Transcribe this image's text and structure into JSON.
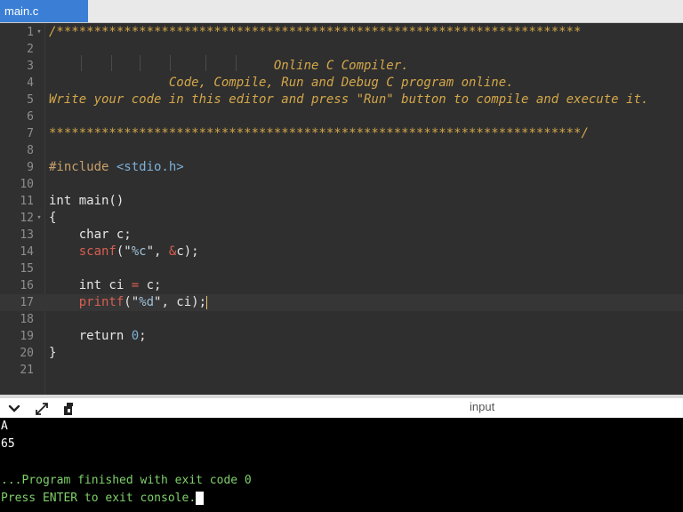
{
  "tab": {
    "label": "main.c"
  },
  "editor": {
    "lines": [
      {
        "num": "1",
        "fold": "-",
        "segments": [
          {
            "t": "/**********************************************************************",
            "c": "cm"
          }
        ]
      },
      {
        "num": "2",
        "fold": "",
        "segments": []
      },
      {
        "num": "3",
        "fold": "",
        "segments": [
          {
            "t": "                              Online C Compiler.",
            "c": "cm"
          }
        ]
      },
      {
        "num": "4",
        "fold": "",
        "segments": [
          {
            "t": "                Code, Compile, Run and Debug C program online.",
            "c": "cm"
          }
        ]
      },
      {
        "num": "5",
        "fold": "",
        "segments": [
          {
            "t": "Write your code in this editor and press \"Run\" button to compile and execute it.",
            "c": "cm"
          }
        ]
      },
      {
        "num": "6",
        "fold": "",
        "segments": []
      },
      {
        "num": "7",
        "fold": "",
        "segments": [
          {
            "t": "***********************************************************************/",
            "c": "cm"
          }
        ]
      },
      {
        "num": "8",
        "fold": "",
        "segments": []
      },
      {
        "num": "9",
        "fold": "",
        "segments": [
          {
            "t": "#include ",
            "c": "pp"
          },
          {
            "t": "<stdio.h>",
            "c": "inc"
          }
        ]
      },
      {
        "num": "10",
        "fold": "",
        "segments": []
      },
      {
        "num": "11",
        "fold": "",
        "segments": [
          {
            "t": "int main()",
            "c": "kw"
          }
        ]
      },
      {
        "num": "12",
        "fold": "-",
        "segments": [
          {
            "t": "{",
            "c": "kw"
          }
        ]
      },
      {
        "num": "13",
        "fold": "",
        "segments": [
          {
            "t": "    char c;",
            "c": "kw"
          }
        ]
      },
      {
        "num": "14",
        "fold": "",
        "segments": [
          {
            "t": "    ",
            "c": "kw"
          },
          {
            "t": "scanf",
            "c": "fn"
          },
          {
            "t": "(\"",
            "c": "str"
          },
          {
            "t": "%c",
            "c": "fmt"
          },
          {
            "t": "\", ",
            "c": "str"
          },
          {
            "t": "&",
            "c": "amp"
          },
          {
            "t": "c);",
            "c": "kw"
          }
        ]
      },
      {
        "num": "15",
        "fold": "",
        "segments": []
      },
      {
        "num": "16",
        "fold": "",
        "segments": [
          {
            "t": "    int ci ",
            "c": "kw"
          },
          {
            "t": "=",
            "c": "op"
          },
          {
            "t": " c;",
            "c": "kw"
          }
        ]
      },
      {
        "num": "17",
        "fold": "",
        "active": true,
        "cursor": true,
        "segments": [
          {
            "t": "    ",
            "c": "kw"
          },
          {
            "t": "printf",
            "c": "fn"
          },
          {
            "t": "(\"",
            "c": "str"
          },
          {
            "t": "%d",
            "c": "fmt"
          },
          {
            "t": "\", ci);",
            "c": "str"
          }
        ]
      },
      {
        "num": "18",
        "fold": "",
        "segments": []
      },
      {
        "num": "19",
        "fold": "",
        "segments": [
          {
            "t": "    return ",
            "c": "kw"
          },
          {
            "t": "0",
            "c": "num"
          },
          {
            "t": ";",
            "c": "kw"
          }
        ]
      },
      {
        "num": "20",
        "fold": "",
        "segments": [
          {
            "t": "}",
            "c": "kw"
          }
        ]
      },
      {
        "num": "21",
        "fold": "",
        "segments": []
      }
    ]
  },
  "toolbar": {
    "input_label": "input",
    "icons": [
      "chevron-down-icon",
      "expand-arrows-icon",
      "copy-icon"
    ]
  },
  "console": {
    "lines": [
      {
        "text": "A",
        "color": "white"
      },
      {
        "text": "65",
        "color": "white"
      },
      {
        "text": "",
        "color": "white"
      },
      {
        "text": "...Program finished with exit code 0",
        "color": "green"
      },
      {
        "text": "Press ENTER to exit console.",
        "color": "green",
        "cursor": true
      }
    ]
  }
}
